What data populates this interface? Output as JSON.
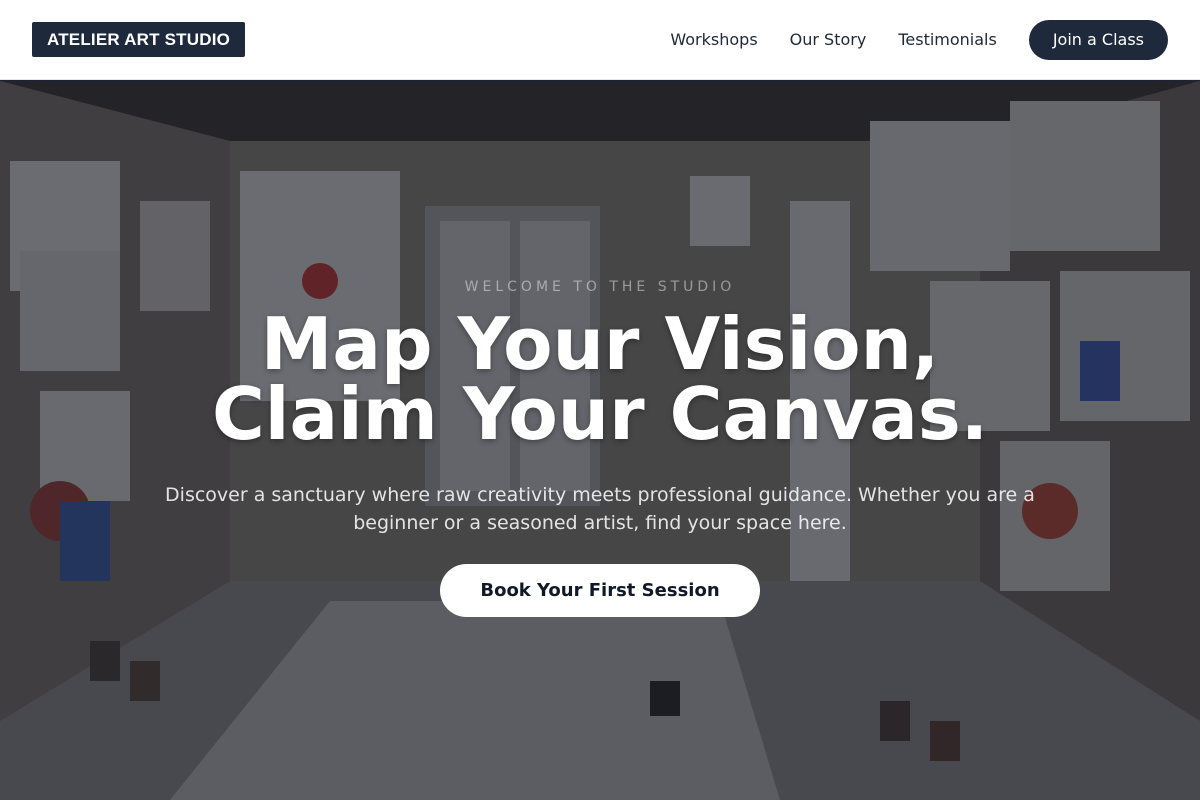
{
  "brand": {
    "logo_text": "ATELIER ART STUDIO"
  },
  "nav": {
    "links": [
      "Workshops",
      "Our Story",
      "Testimonials"
    ],
    "cta_label": "Join a Class"
  },
  "hero": {
    "eyebrow": "WELCOME TO THE STUDIO",
    "headline_line1": "Map Your Vision,",
    "headline_line2": "Claim Your Canvas.",
    "subtext": "Discover a sanctuary where raw creativity meets professional guidance. Whether you are a beginner or a seasoned artist, find your space here.",
    "cta_label": "Book Your First Session",
    "background_image": "art-studio-room-with-paintings"
  },
  "colors": {
    "brand_dark": "#1e293b",
    "overlay": "#111626",
    "white": "#ffffff"
  }
}
